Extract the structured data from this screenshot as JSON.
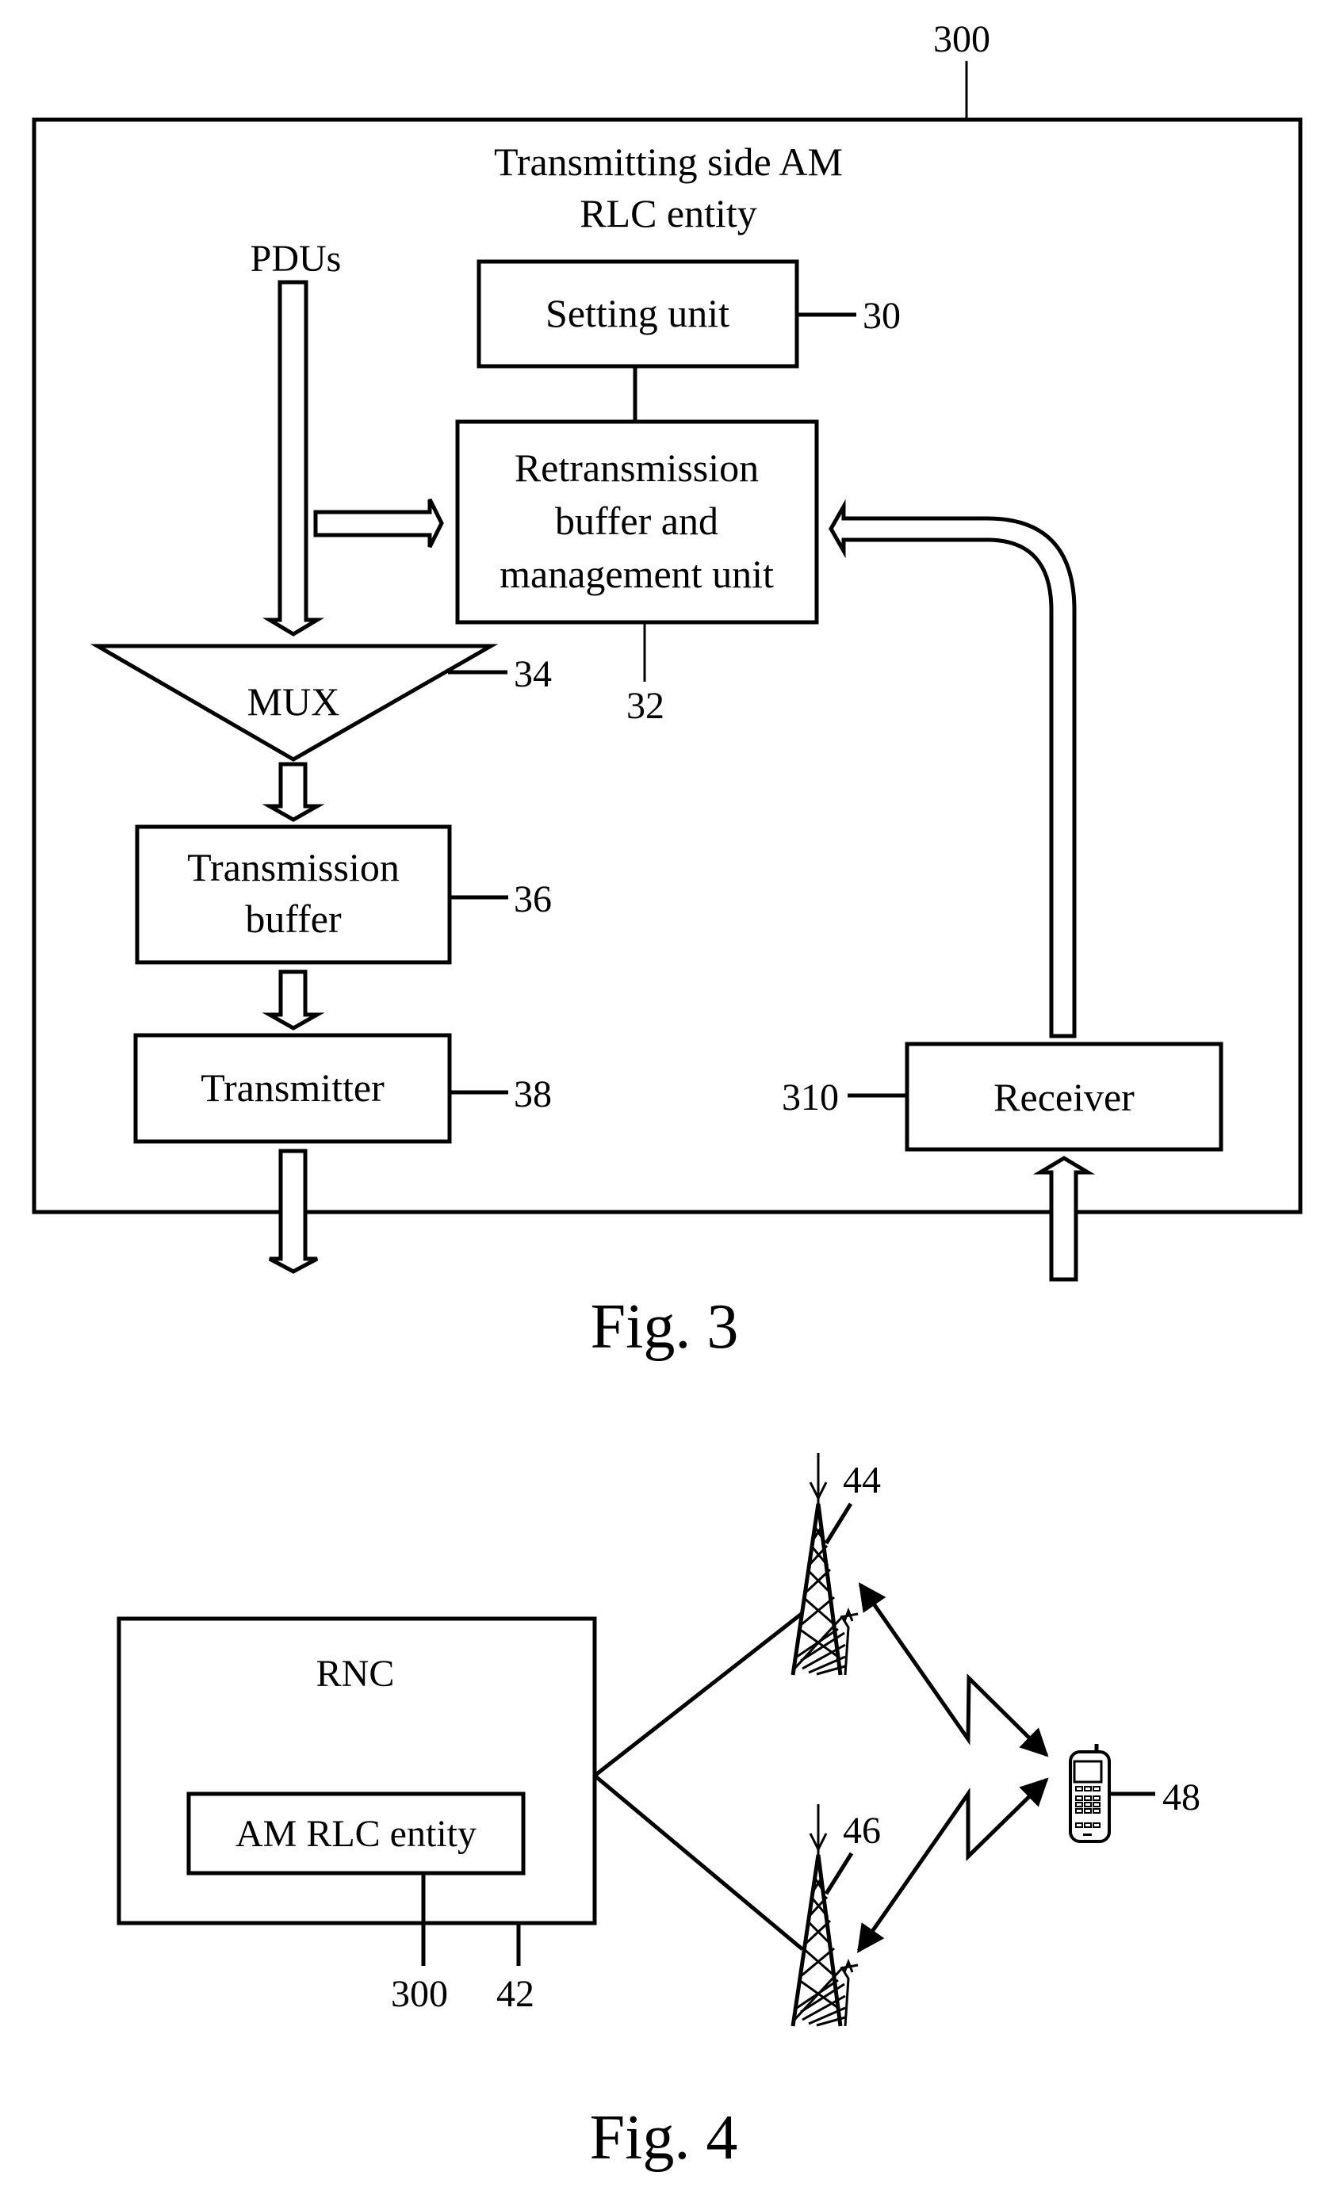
{
  "fig3": {
    "caption": "Fig. 3",
    "entity": {
      "ref": "300",
      "title_line1": "Transmitting side AM",
      "title_line2": "RLC entity"
    },
    "input_label": "PDUs",
    "blocks": {
      "setting_unit": {
        "label": "Setting unit",
        "ref": "30"
      },
      "retransmission": {
        "line1": "Retransmission",
        "line2": "buffer and",
        "line3": "management unit",
        "ref": "32"
      },
      "mux": {
        "label": "MUX",
        "ref": "34"
      },
      "transmission_buffer": {
        "line1": "Transmission",
        "line2": "buffer",
        "ref": "36"
      },
      "transmitter": {
        "label": "Transmitter",
        "ref": "38"
      },
      "receiver": {
        "label": "Receiver",
        "ref": "310"
      }
    }
  },
  "fig4": {
    "caption": "Fig. 4",
    "rnc": {
      "label": "RNC",
      "ref": "42"
    },
    "am_rlc": {
      "label": "AM RLC entity",
      "ref": "300"
    },
    "base_station_1": {
      "ref": "44",
      "icon": "cell-tower-icon"
    },
    "base_station_2": {
      "ref": "46",
      "icon": "cell-tower-icon"
    },
    "mobile": {
      "ref": "48",
      "icon": "mobile-phone-icon"
    }
  },
  "colors": {
    "ink": "#000000",
    "paper": "#ffffff"
  }
}
